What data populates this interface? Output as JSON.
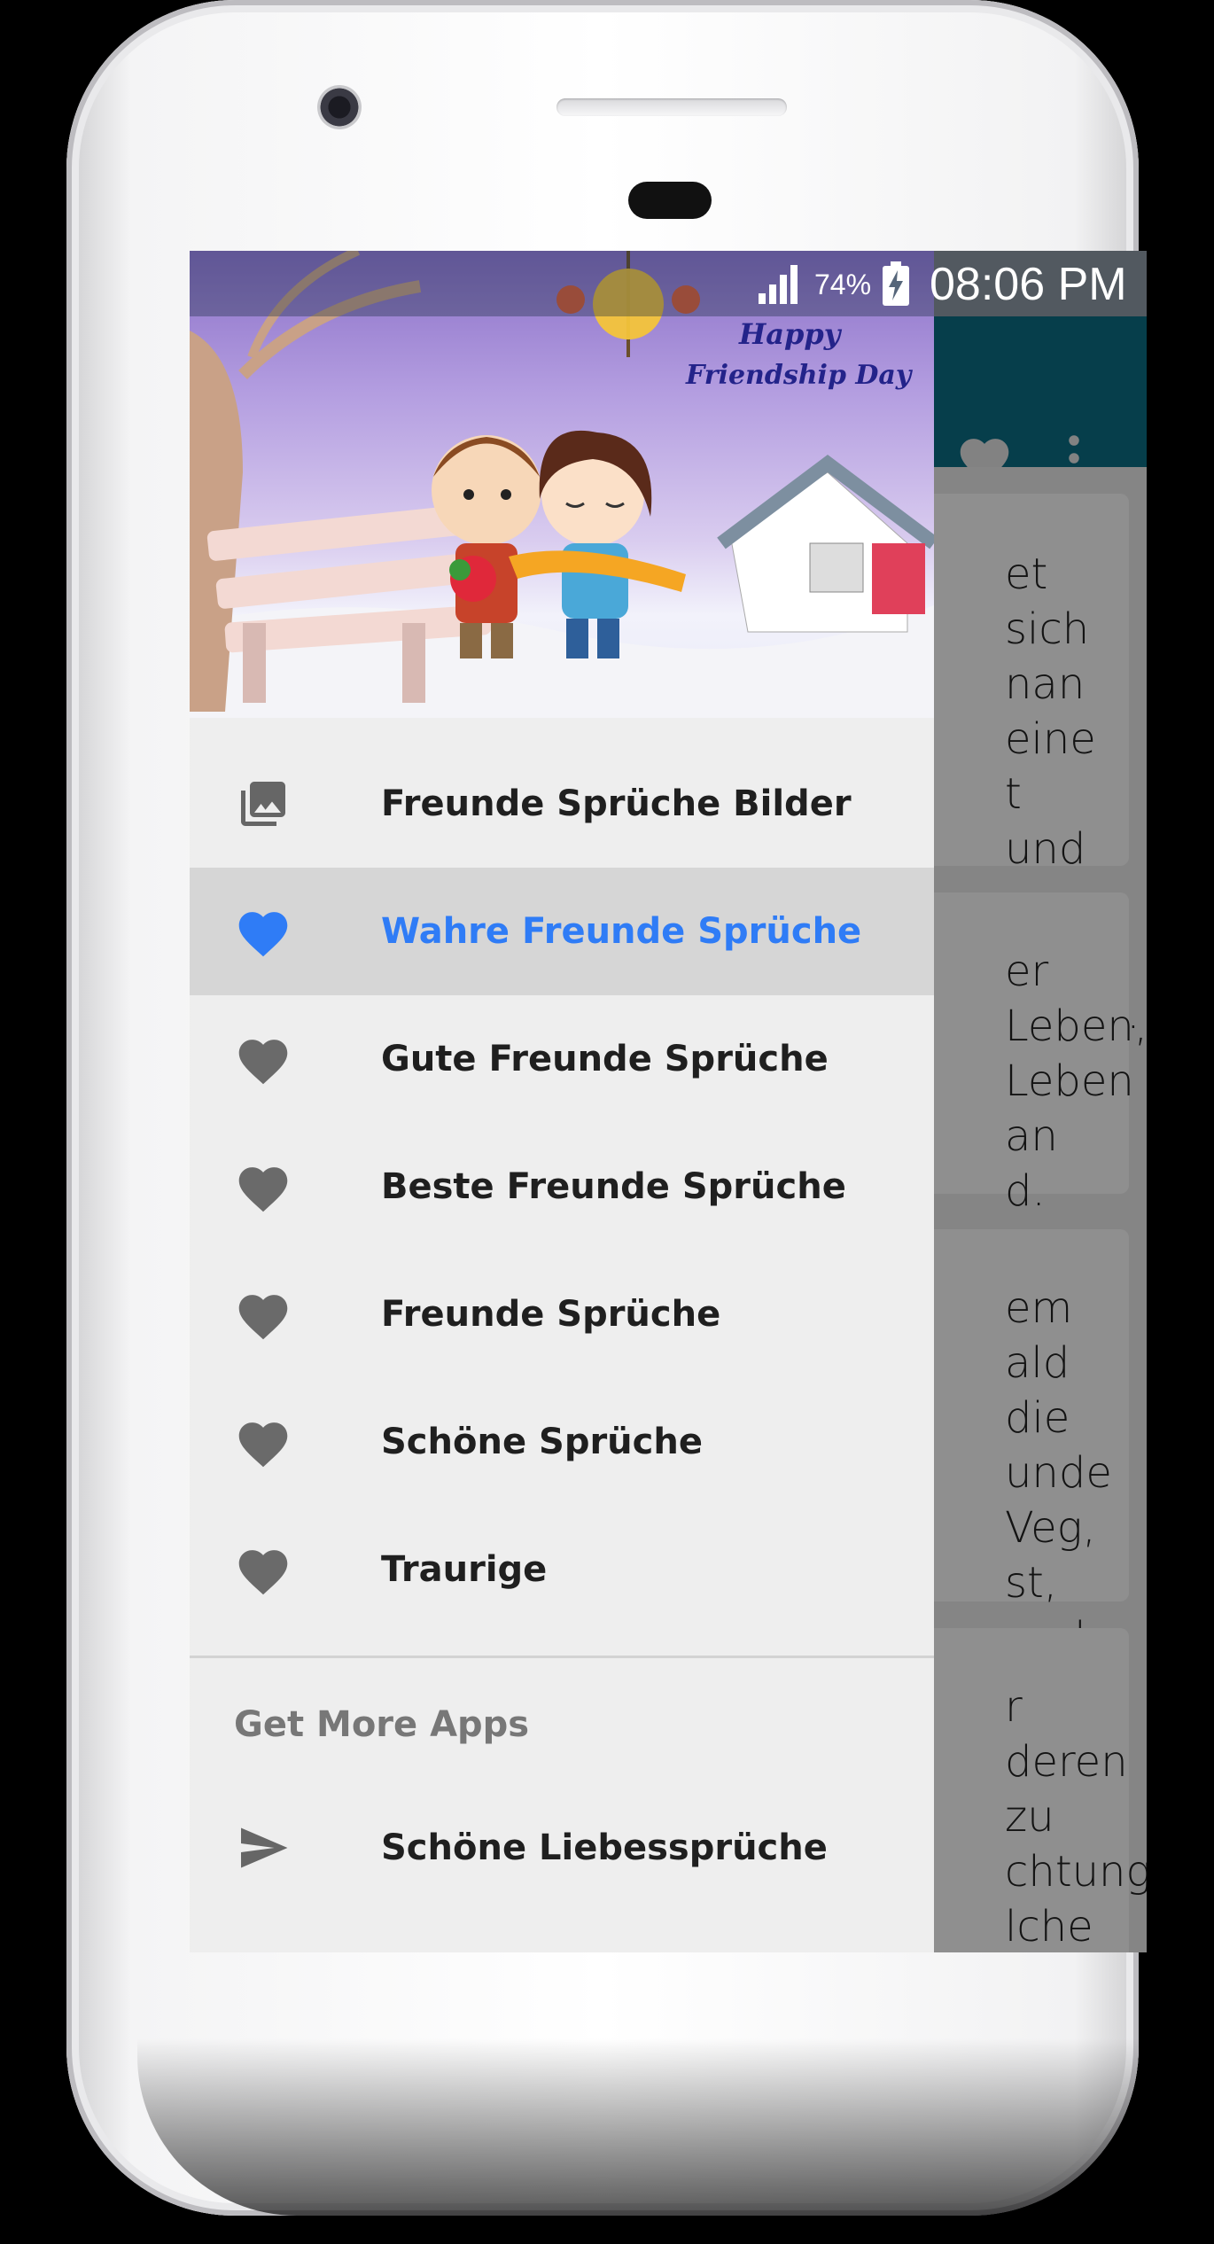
{
  "status_bar": {
    "battery": "74%",
    "time": "08:06 PM"
  },
  "header_image": {
    "caption_line1": "Happy",
    "caption_line2": "Friendship Day"
  },
  "background_cards": [
    {
      "text": "et sich\nnan eine\nt und\nnan weiß,\nnem..."
    },
    {
      "text": "er Leben,\nLeben\nan\nd."
    },
    {
      "text": "em\nald die\nunde\nVeg,\nst, und..."
    },
    {
      "text": "r\nderen zu\nchtung\nlche ist,\nahren."
    }
  ],
  "drawer": {
    "items": [
      {
        "label": "Freunde Sprüche Bilder",
        "icon": "photo-library-icon"
      },
      {
        "label": "Wahre Freunde Sprüche",
        "icon": "heart-icon",
        "active": true
      },
      {
        "label": "Gute Freunde Sprüche",
        "icon": "heart-icon"
      },
      {
        "label": "Beste Freunde Sprüche",
        "icon": "heart-icon"
      },
      {
        "label": "Freunde Sprüche",
        "icon": "heart-icon"
      },
      {
        "label": "Schöne Sprüche",
        "icon": "heart-icon"
      },
      {
        "label": "Traurige",
        "icon": "heart-icon"
      }
    ],
    "section_title": "Get More Apps",
    "more_apps": [
      {
        "label": "Schöne Liebessprüche",
        "icon": "send-icon"
      }
    ]
  },
  "colors": {
    "accent": "#2f7cf6",
    "appbar": "#0b6b82",
    "icon_gray": "#6a6a6a"
  }
}
